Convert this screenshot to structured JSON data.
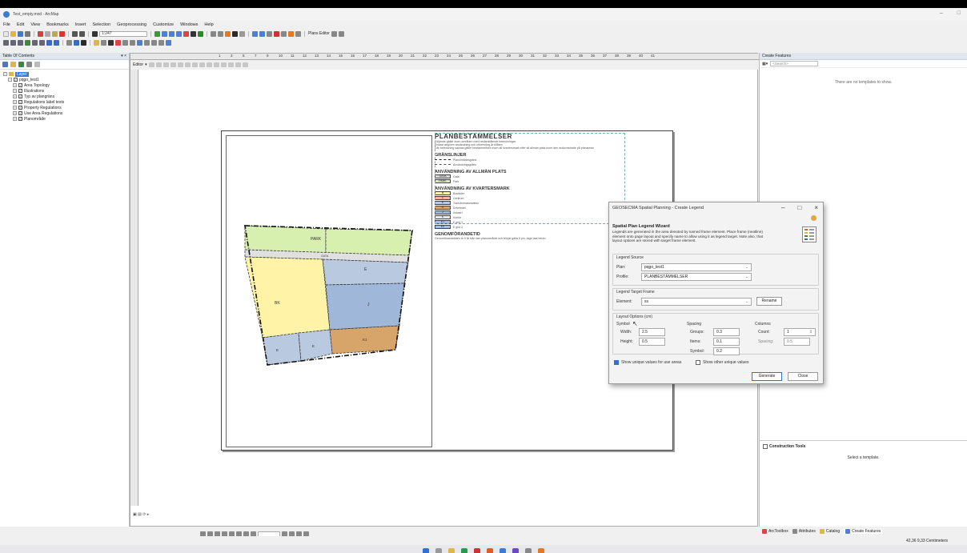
{
  "window": {
    "title": "Test_empty.mxd - ArcMap"
  },
  "menu": [
    "File",
    "Edit",
    "View",
    "Bookmarks",
    "Insert",
    "Selection",
    "Geoprocessing",
    "Customize",
    "Windows",
    "Help"
  ],
  "toolbar": {
    "scale": "1:247",
    "plans_editor_label": "Plans Editor"
  },
  "toc": {
    "title": "Table Of Contents",
    "root": "Layer",
    "group": "pqgo_test1",
    "layers": [
      "Area Topology",
      "Illustrations",
      "Typ av plangräns",
      "Regulations label texts",
      "Property Regulations",
      "Use Area Regulations",
      "Planområde"
    ]
  },
  "editor": {
    "label": "Editor"
  },
  "ruler": {
    "ticks": [
      "1",
      "3",
      "5",
      "7",
      "9",
      "10",
      "11",
      "12",
      "13",
      "14",
      "15",
      "16",
      "17",
      "18",
      "19",
      "20",
      "21",
      "22",
      "23",
      "24",
      "25",
      "26",
      "27",
      "28",
      "29",
      "30",
      "31",
      "32",
      "33",
      "34",
      "35",
      "36",
      "37",
      "38",
      "39",
      "40",
      "41"
    ]
  },
  "map": {
    "labels": {
      "park": "PARK",
      "gata": "GATA",
      "bk": "BK",
      "e1": "E",
      "e2": "E",
      "e3": "E",
      "j": "J",
      "k": "K1"
    }
  },
  "legend": {
    "title": "PLANBESTÄMMELSER",
    "intro": [
      "Följande gäller inom områden med nedanstående beteckningar",
      "Endast angiven användning och utformning är tillåten",
      "Där beteckning saknas gäller bestämmelsen inom all kvartersmark eller all allmän plats inom den avdovnstrade på planarean"
    ],
    "s1": "GRÄNSLINJER",
    "s1_items": [
      "Planområdesgräns",
      "Användningsgräns"
    ],
    "s2": "ANVÄNDNING AV ALLMÄN PLATS",
    "s2_items": [
      {
        "code": "GATA",
        "text": "Gata",
        "color": "#d9d9d9"
      },
      {
        "code": "PARK",
        "text": "Park",
        "color": "#d7f0b0"
      }
    ],
    "s3": "ANVÄNDNING AV KVARTERSMARK",
    "s3_items": [
      {
        "code": "B",
        "text": "Bostäder",
        "color": "#fff3a8"
      },
      {
        "code": "C",
        "text": "Centrum",
        "color": "#f4b3a8"
      },
      {
        "code": "E",
        "text": "Transformatorstation",
        "color": "#b9c9e0"
      },
      {
        "code": "G",
        "text": "Drivmedel",
        "color": "#d7a56a"
      },
      {
        "code": "J",
        "text": "Industri",
        "color": "#9fb7d8"
      },
      {
        "code": "K",
        "text": "Kontor",
        "color": "#e9e9e9"
      },
      {
        "code": "E1",
        "text": "E grid 1",
        "color": "#a8bfe0"
      },
      {
        "code": "E2",
        "text": "E grid 2",
        "color": "#a8bfe0"
      }
    ],
    "s4": "GENOMFÖRANDETID",
    "s4_text": "Genomförandetiden är 5 år från den planområdet och börjar gälla 5 ym. tage laat beum."
  },
  "dialog": {
    "title": "GEOSECMA Spatial Planning - Create Legend",
    "wizard_title": "Spatial Plan Legend Wizard",
    "wizard_desc": [
      "Legends are generated in the area denoted by named frame element. Place frame (neatline)",
      "element onto page layout and specify name to allow using it as legend target. Note also, that",
      "layout options are stored with target frame element."
    ],
    "legend_source": "Legend Source",
    "plan_label": "Plan:",
    "plan_value": "pqgo_test1",
    "profile_label": "Profile:",
    "profile_value": "PLANBESTÄMMELSER",
    "target_frame": "Legend Target Frame",
    "element_label": "Element:",
    "element_value": "ss",
    "rename_label": "Rename",
    "layout_options": "Layout Options (cm)",
    "symbol_label": "Symbol",
    "width_label": "Width:",
    "width_value": "2.5",
    "height_label": "Height:",
    "height_value": "0.5",
    "spacing_label": "Spacing",
    "groups_label": "Groups:",
    "groups_value": "0.3",
    "items_label": "Items:",
    "items_value": "0.1",
    "symbol2_label": "Symbol:",
    "symbol2_value": "0.2",
    "columns_label": "Columns",
    "count_label": "Count:",
    "count_value": "1",
    "colspacing_label": "Spacing:",
    "colspacing_value": "0.5",
    "unique_label": "Show unique values for use areas",
    "other_label": "Show other unique values",
    "generate_label": "Generate",
    "close_label": "Close"
  },
  "create_features": {
    "title": "Create Features",
    "search": "<Search>",
    "empty": "There are no templates to show.",
    "construction": "Construction Tools",
    "select": "Select a template."
  },
  "tabs": [
    "ArcToolbox",
    "Attributes",
    "Catalog",
    "Create Features"
  ],
  "status": {
    "coords": "42,36  9,33 Centimeters"
  }
}
